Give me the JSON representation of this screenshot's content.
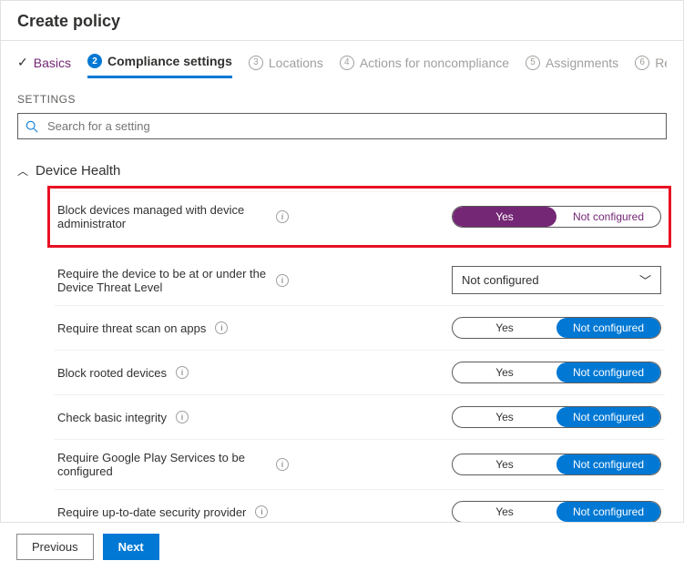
{
  "header": {
    "title": "Create policy"
  },
  "tabs": {
    "items": [
      {
        "label": "Basics"
      },
      {
        "label": "Compliance settings"
      },
      {
        "label": "Locations"
      },
      {
        "label": "Actions for noncompliance"
      },
      {
        "label": "Assignments"
      },
      {
        "label": "Review"
      }
    ]
  },
  "settings_label": "SETTINGS",
  "search": {
    "placeholder": "Search for a setting"
  },
  "section": {
    "title": "Device Health"
  },
  "toggle_labels": {
    "yes": "Yes",
    "not_configured": "Not configured"
  },
  "rows": [
    {
      "label": "Block devices managed with device administrator",
      "control": "pill-purple",
      "selected": "yes",
      "highlight": true
    },
    {
      "label": "Require the device to be at or under the Device Threat Level",
      "control": "dropdown",
      "value": "Not configured"
    },
    {
      "label": "Require threat scan on apps",
      "control": "pill-blue",
      "selected": "not_configured"
    },
    {
      "label": "Block rooted devices",
      "control": "pill-blue",
      "selected": "not_configured"
    },
    {
      "label": "Check basic integrity",
      "control": "pill-blue",
      "selected": "not_configured"
    },
    {
      "label": "Require Google Play Services to be configured",
      "control": "pill-blue",
      "selected": "not_configured"
    },
    {
      "label": "Require up-to-date security provider",
      "control": "pill-blue",
      "selected": "not_configured"
    }
  ],
  "footer": {
    "previous": "Previous",
    "next": "Next"
  }
}
